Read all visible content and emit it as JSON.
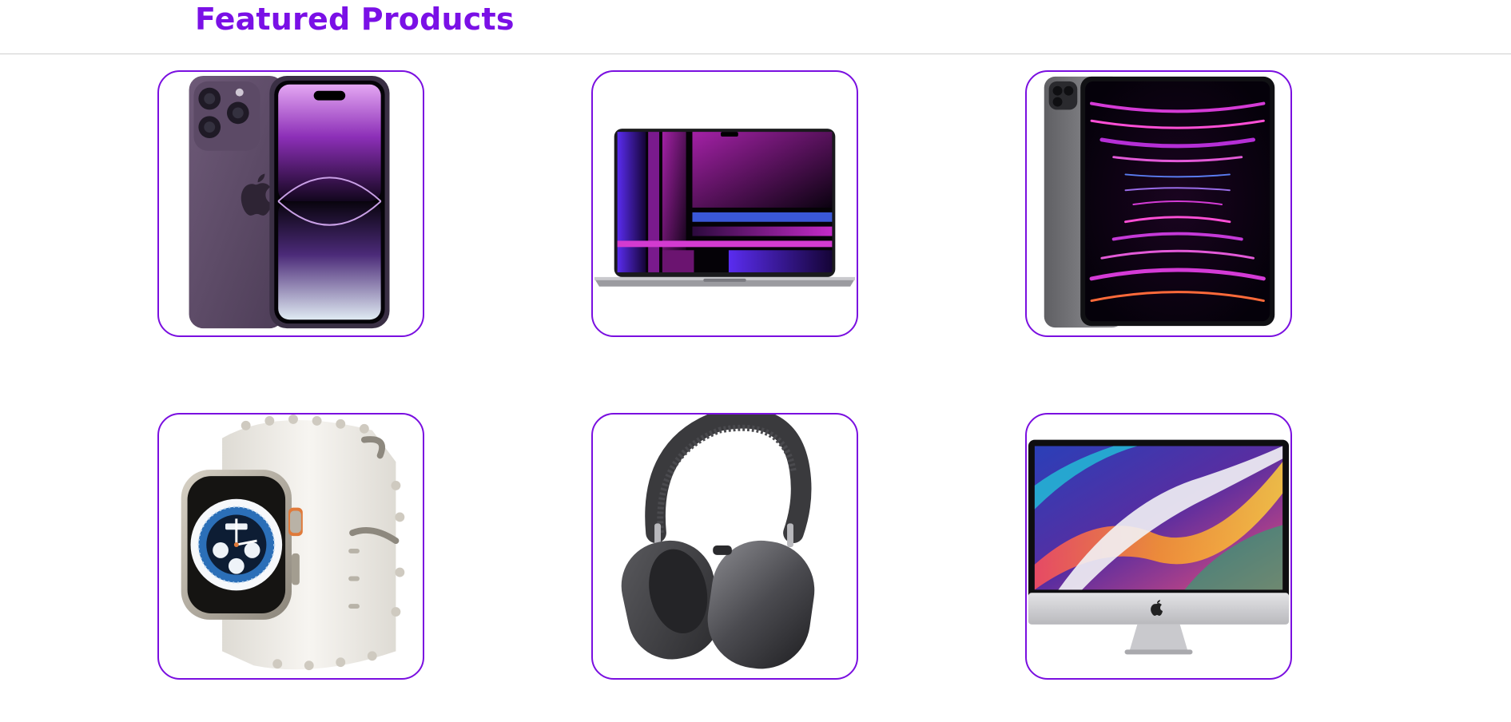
{
  "section": {
    "title": "Featured Products"
  },
  "colors": {
    "accent": "#7a10e6",
    "card_border": "#7a0fe0",
    "divider": "#cfcfcf"
  },
  "products": [
    {
      "image": "iphone-pro-deep-purple"
    },
    {
      "image": "macbook-pro"
    },
    {
      "image": "ipad-pro"
    },
    {
      "image": "apple-watch-ultra"
    },
    {
      "image": "airpods-max"
    },
    {
      "image": "imac"
    }
  ]
}
